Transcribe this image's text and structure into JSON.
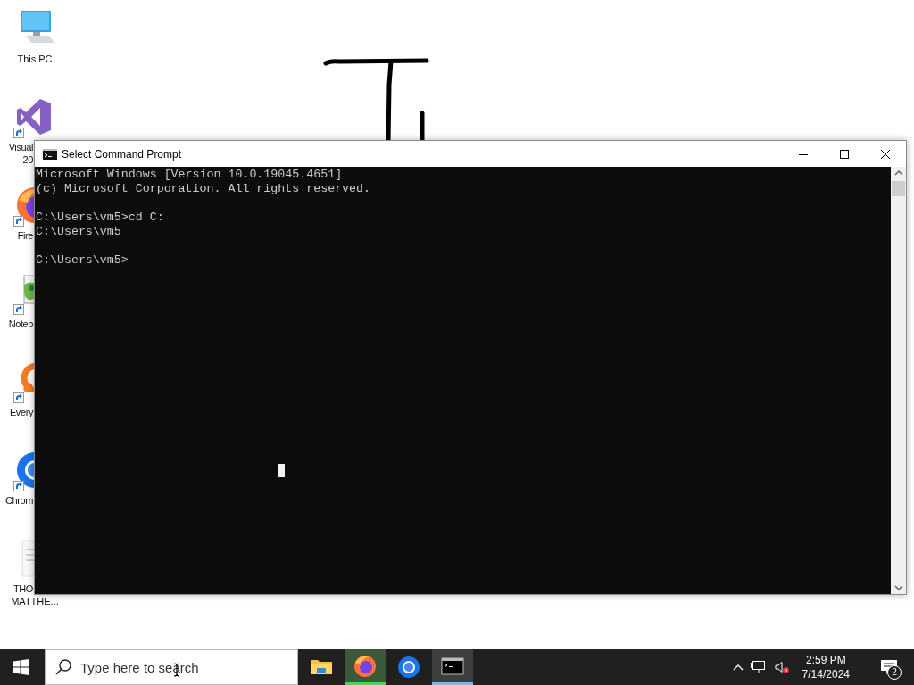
{
  "desktop": {
    "icons": [
      {
        "kind": "pc",
        "lines": [
          {
            "text": "This PC",
            "clipped": false
          }
        ],
        "shortcut": false,
        "covered": false
      },
      {
        "kind": "vs",
        "lines": [
          {
            "text": "Visual",
            "clipped": true
          },
          {
            "text": "20",
            "clipped": true
          }
        ],
        "shortcut": true,
        "covered": false
      },
      {
        "kind": "firefox",
        "lines": [
          {
            "text": "Fire",
            "clipped": true
          }
        ],
        "shortcut": true,
        "covered": true
      },
      {
        "kind": "notepad",
        "lines": [
          {
            "text": "Notep",
            "clipped": true
          }
        ],
        "shortcut": true,
        "covered": true
      },
      {
        "kind": "everything",
        "lines": [
          {
            "text": "Every",
            "clipped": true
          }
        ],
        "shortcut": true,
        "covered": true
      },
      {
        "kind": "chrome",
        "lines": [
          {
            "text": "Chrom",
            "clipped": true
          }
        ],
        "shortcut": true,
        "covered": true
      },
      {
        "kind": "document",
        "lines": [
          {
            "text": "THO",
            "clipped": true
          },
          {
            "text": "MATTHE...",
            "clipped": false
          }
        ],
        "shortcut": false,
        "covered": true
      }
    ]
  },
  "window": {
    "title": "Select Command Prompt",
    "console": {
      "blocks": [
        [
          "Microsoft Windows [Version 10.0.19045.4651]",
          "(c) Microsoft Corporation. All rights reserved."
        ],
        [
          "C:\\Users\\vm5>cd C:",
          "C:\\Users\\vm5"
        ],
        [
          "C:\\Users\\vm5>"
        ]
      ]
    }
  },
  "taskbar": {
    "search": {
      "placeholder": "Type here to search"
    },
    "apps": [
      {
        "kind": "explorer",
        "active": false,
        "flashing": false
      },
      {
        "kind": "firefox",
        "active": false,
        "flashing": true
      },
      {
        "kind": "chrome",
        "active": false,
        "flashing": false
      },
      {
        "kind": "terminal",
        "active": true,
        "flashing": false
      }
    ],
    "clock": {
      "time": "2:59 PM",
      "date": "7/14/2024"
    },
    "notifications": {
      "count": "2"
    }
  }
}
